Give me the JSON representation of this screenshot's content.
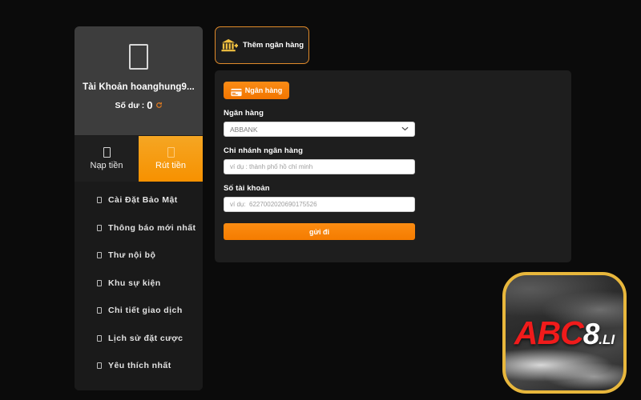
{
  "sidebar": {
    "avatar_icon": "user-placeholder-icon",
    "account_name": "Tài Khoản hoanghung9...",
    "balance_label": "Số dư :",
    "balance_value": "0",
    "refresh_icon": "refresh-icon",
    "tabs": [
      {
        "label": "Nạp tiền",
        "icon": "deposit-icon",
        "active": false
      },
      {
        "label": "Rút tiền",
        "icon": "withdraw-icon",
        "active": true
      }
    ],
    "menu_items": [
      {
        "label": "Cài Đặt Bảo Mật",
        "icon": "security-icon"
      },
      {
        "label": "Thông báo mới nhất",
        "icon": "notification-icon"
      },
      {
        "label": "Thư nội bộ",
        "icon": "mail-icon"
      },
      {
        "label": "Khu sự kiện",
        "icon": "event-icon"
      },
      {
        "label": "Chi tiết giao dịch",
        "icon": "transaction-icon"
      },
      {
        "label": "Lịch sử đặt cược",
        "icon": "bet-history-icon"
      },
      {
        "label": "Yêu thích nhất",
        "icon": "favorite-icon"
      }
    ]
  },
  "main": {
    "add_bank_button": {
      "label": "Thêm ngân hàng",
      "icon": "bank-plus-icon"
    },
    "panel": {
      "bank_tab": {
        "label": "Ngân hàng",
        "icon": "bank-card-icon"
      },
      "fields": [
        {
          "label": "Ngân hàng",
          "type": "select",
          "value": "ABBANK",
          "placeholder": "",
          "chevron_icon": "chevron-down-icon"
        },
        {
          "label": "Chi nhánh ngân hàng",
          "type": "text",
          "value": "",
          "placeholder": "ví dụ : thành phố hồ chí minh"
        },
        {
          "label": "Số tài khoản",
          "type": "text",
          "value": "",
          "placeholder": "ví dụ:  6227002020690175526"
        }
      ],
      "submit_label": "gửi đi"
    }
  },
  "logo": {
    "text_red": "ABC",
    "text_white_num": "8",
    "text_white_suffix": ".LI"
  },
  "colors": {
    "accent_orange": "#f57c00",
    "accent_orange_light": "#f5a623",
    "gold_border": "#e8b73c",
    "panel_bg": "#1e1e1e",
    "sidebar_card_bg": "#3d3d3d",
    "page_bg": "#0b0b0b",
    "logo_red": "#f01b1b"
  }
}
